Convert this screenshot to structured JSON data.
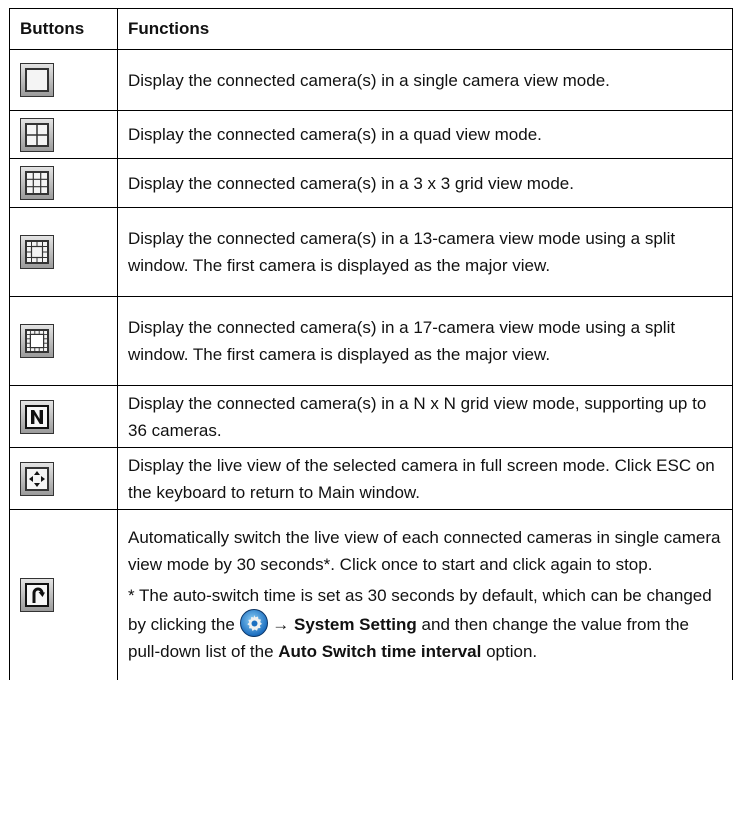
{
  "header": {
    "col1": "Buttons",
    "col2": "Functions"
  },
  "rows": [
    {
      "icon": "single-view-icon",
      "text": "Display the connected camera(s) in a single camera view mode."
    },
    {
      "icon": "quad-view-icon",
      "text": "Display the connected camera(s) in a quad view mode."
    },
    {
      "icon": "grid-3x3-icon",
      "text": "Display the connected camera(s) in a 3 x 3 grid view mode."
    },
    {
      "icon": "split-13-icon",
      "text": "Display the connected camera(s) in a 13-camera view mode using a split window. The first camera is displayed as the major view."
    },
    {
      "icon": "split-17-icon",
      "text": "Display the connected camera(s) in a 17-camera view mode using a split window. The first camera is displayed as the major view."
    },
    {
      "icon": "nxn-grid-icon",
      "text": "Display the connected camera(s) in a N x N grid view mode, supporting up to 36 cameras."
    },
    {
      "icon": "fullscreen-icon",
      "text": "Display the live view of the selected camera in full screen mode.  Click ESC on the keyboard to return to Main window."
    },
    {
      "icon": "auto-switch-icon",
      "text": "Automatically switch the live view of each connected cameras in single camera view mode by 30 seconds*. Click once to start and click again to stop.",
      "note_pre": "* The auto-switch time is set as 30 seconds by default, which can be changed by clicking the",
      "note_link": "System Setting",
      "note_mid": "and then change the value from the pull-down list of the",
      "note_option": "Auto Switch time interval",
      "note_post": "option."
    }
  ],
  "icons": {
    "inline_settings": "gear-icon",
    "arrow": "→"
  },
  "colors": {
    "button_border": "#333333",
    "gear_blue": "#1d6fc0"
  }
}
